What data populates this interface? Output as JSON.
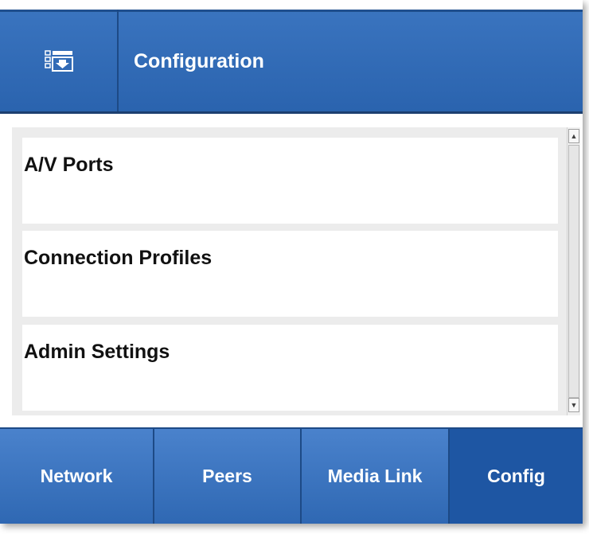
{
  "header": {
    "title": "Configuration",
    "icon": "config-download-icon"
  },
  "menu": {
    "items": [
      {
        "label": "A/V Ports"
      },
      {
        "label": "Connection Profiles"
      },
      {
        "label": "Admin Settings"
      }
    ]
  },
  "nav": {
    "tabs": [
      {
        "label": "Network"
      },
      {
        "label": "Peers"
      },
      {
        "label": "Media Link"
      },
      {
        "label": "Config"
      }
    ],
    "active": "Config"
  },
  "colors": {
    "primary_blue": "#2a63ae",
    "dark_blue_border": "#1d4a86",
    "list_background": "#ececec"
  },
  "scrollbar": {
    "up_arrow": "▲",
    "down_arrow": "▼"
  }
}
